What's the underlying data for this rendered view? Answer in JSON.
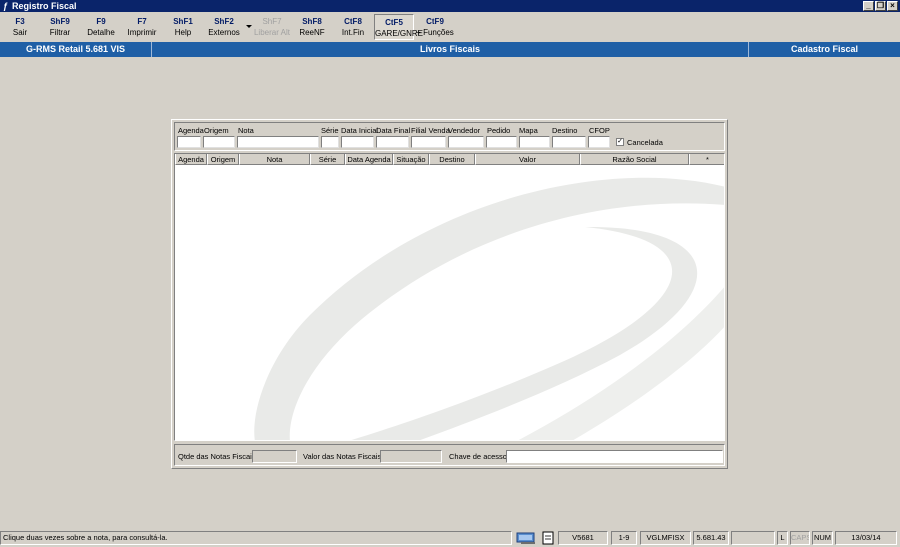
{
  "window": {
    "title": "Registro Fiscal"
  },
  "toolbar": {
    "buttons": [
      {
        "key": "F3",
        "label": "Sair"
      },
      {
        "key": "ShF9",
        "label": "Filtrar"
      },
      {
        "key": "F9",
        "label": "Detalhe"
      },
      {
        "key": "F7",
        "label": "Imprimir"
      },
      {
        "key": "ShF1",
        "label": "Help"
      },
      {
        "key": "ShF2",
        "label": "Externos"
      },
      {
        "key": "ShF7",
        "label": "Liberar Alt"
      },
      {
        "key": "ShF8",
        "label": "ReeNF"
      },
      {
        "key": "CtF8",
        "label": "Int.Fin"
      },
      {
        "key": "CtF5",
        "label": "GARE/GNRE"
      },
      {
        "key": "CtF9",
        "label": "+ Funções"
      }
    ]
  },
  "band": {
    "left": "G-RMS Retail 5.681 VIS",
    "center": "Livros Fiscais",
    "right": "Cadastro Fiscal"
  },
  "filters": {
    "labels": [
      "Agenda",
      "Origem",
      "Nota",
      "Série",
      "Data Inicial",
      "Data Final",
      "Filial Venda",
      "Vendedor",
      "Pedido",
      "Mapa",
      "Destino",
      "CFOP"
    ],
    "cancelada_label": "Cancelada",
    "cancelada_mark": "✓"
  },
  "grid": {
    "columns": [
      "Agenda",
      "Origem",
      "Nota",
      "Série",
      "Data Agenda",
      "Situação",
      "Destino",
      "Valor",
      "Razão Social",
      "*"
    ]
  },
  "panel_footer": {
    "qtde_label": "Qtde das Notas Fiscais:",
    "valor_label": "Valor  das Notas Fiscais:",
    "chave_label": "Chave de acesso:"
  },
  "statusbar": {
    "message": "Clique duas vezes sobre a nota, para consultá-la.",
    "cells": [
      "V5681",
      "1-9",
      "VGLMFISX",
      "5.681.43",
      "",
      "L",
      "CAPS",
      "NUM",
      "13/03/14"
    ]
  }
}
